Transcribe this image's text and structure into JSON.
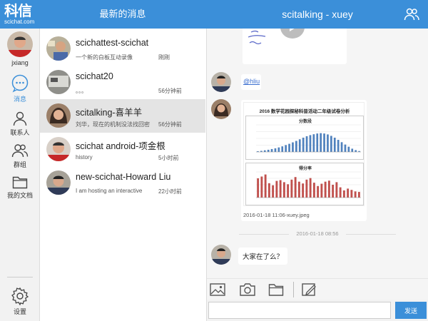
{
  "app": {
    "logo_cn": "科信",
    "logo_en": "scichat.com"
  },
  "header": {
    "list_title": "最新的消息",
    "chat_title": "scitalking - xuey"
  },
  "nav": {
    "user_name": "jxiang",
    "items": [
      {
        "label": "消息",
        "icon": "chat-bubble-icon",
        "active": true
      },
      {
        "label": "联系人",
        "icon": "person-icon"
      },
      {
        "label": "群组",
        "icon": "group-icon"
      },
      {
        "label": "我的文档",
        "icon": "folder-icon"
      }
    ],
    "settings_label": "设置"
  },
  "conversations": [
    {
      "name": "scichattest-scichat",
      "preview": "一个新的白板互动录像",
      "time": "刚刚"
    },
    {
      "name": "scichat20",
      "preview": "。。。",
      "time": "56分钟前"
    },
    {
      "name": "scitalking-喜羊羊",
      "preview": "刘华，现在的机制没法找回密",
      "time": "56分钟前",
      "active": true
    },
    {
      "name": "scichat android-项金根",
      "preview": "history",
      "time": "5小时前"
    },
    {
      "name": "new-scichat-Howard Liu",
      "preview": "I am hosting an interactive",
      "time": "22小时前"
    }
  ],
  "messages": {
    "mention": "@hliu",
    "image_title": "2016 数学花园探秘科普活动二年级试卷分析",
    "image_sub1": "分数段",
    "image_sub2": "得分率",
    "image_caption": "2016-01-18 11:06-xuey.jpeg",
    "timestamp": "2016-01-18 08:56",
    "last_text": "大家在了么？"
  },
  "composer": {
    "placeholder": "",
    "send_label": "发送"
  },
  "colors": {
    "brand": "#3b8fd9",
    "bar_blue": "#4f81bd",
    "bar_red": "#c0504d"
  },
  "chart_data": [
    {
      "type": "bar",
      "title": "分数段",
      "categories": [],
      "values": [
        0.4,
        0.6,
        0.9,
        1.2,
        1.6,
        2.0,
        2.5,
        3.1,
        3.8,
        4.5,
        5.3,
        6.1,
        7.0,
        7.9,
        8.7,
        9.3,
        9.8,
        10.2,
        10.4,
        10.2,
        9.7,
        8.9,
        7.9,
        6.7,
        5.4,
        4.1,
        2.9,
        1.8,
        1.0,
        0.5
      ],
      "ylim": [
        0,
        15
      ],
      "color": "#4f81bd"
    },
    {
      "type": "bar",
      "title": "得分率",
      "categories": [],
      "values": [
        75,
        82,
        90,
        56,
        48,
        65,
        68,
        60,
        52,
        70,
        80,
        62,
        55,
        70,
        76,
        58,
        45,
        54,
        62,
        66,
        50,
        60,
        40,
        28,
        35,
        30,
        24,
        22
      ],
      "ylim": [
        0,
        100
      ],
      "color": "#c0504d"
    }
  ]
}
